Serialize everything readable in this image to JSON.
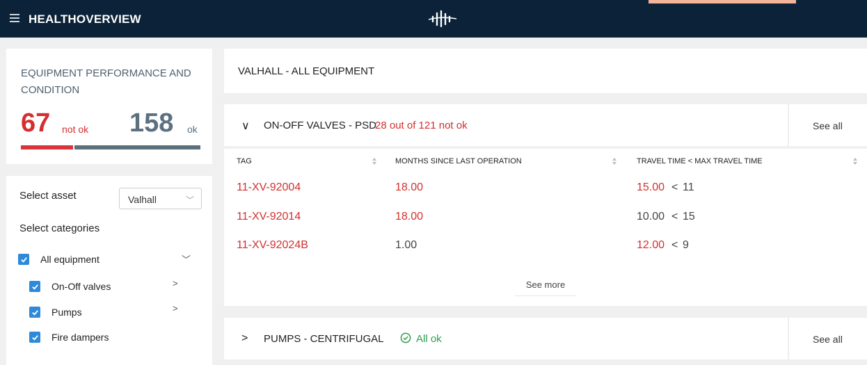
{
  "topbar": {
    "title": "HEALTHOVERVIEW",
    "menu_icon": "hamburger-icon",
    "logo_icon": "company-logo",
    "bg_color": "#0b2238"
  },
  "summary": {
    "title": "EQUIPMENT PERFORMANCE AND CONDITION",
    "not_ok_count": "67",
    "not_ok_label": "not ok",
    "ok_count": "158",
    "ok_label": "ok",
    "not_ok_color": "#d32f2f",
    "ok_color": "#5c6f7d"
  },
  "filters": {
    "select_asset_label": "Select asset",
    "asset_value": "Valhall",
    "select_categories_label": "Select categories",
    "categories": [
      {
        "label": "All equipment",
        "checked": true
      },
      {
        "label": "On-Off valves",
        "checked": true
      },
      {
        "label": "Pumps",
        "checked": true
      },
      {
        "label": "Fire dampers",
        "checked": true
      }
    ],
    "checkbox_color": "#2d89d9"
  },
  "main": {
    "header_title": "VALHALL - ALL EQUIPMENT",
    "sections": [
      {
        "title": "ON-OFF VALVES - PSD",
        "status": "28 out of 121 not ok",
        "see_all": "See all",
        "expanded": true,
        "columns": [
          "TAG",
          "MONTHS SINCE LAST OPERATION",
          "TRAVEL TIME < MAX TRAVEL TIME"
        ],
        "rows": [
          {
            "tag": "11-XV-92004",
            "months": "18.00",
            "travel": "15.00",
            "lt": "<",
            "max": "11"
          },
          {
            "tag": "11-XV-92014",
            "months": "18.00",
            "travel": "10.00",
            "lt": "<",
            "max": "15"
          },
          {
            "tag": "11-XV-92024B",
            "months": "1.00",
            "travel": "12.00",
            "lt": "<",
            "max": "9"
          }
        ],
        "see_more": "See more"
      },
      {
        "title": "PUMPS - CENTRIFUGAL",
        "status": "All ok",
        "see_all": "See all",
        "expanded": false
      }
    ]
  }
}
